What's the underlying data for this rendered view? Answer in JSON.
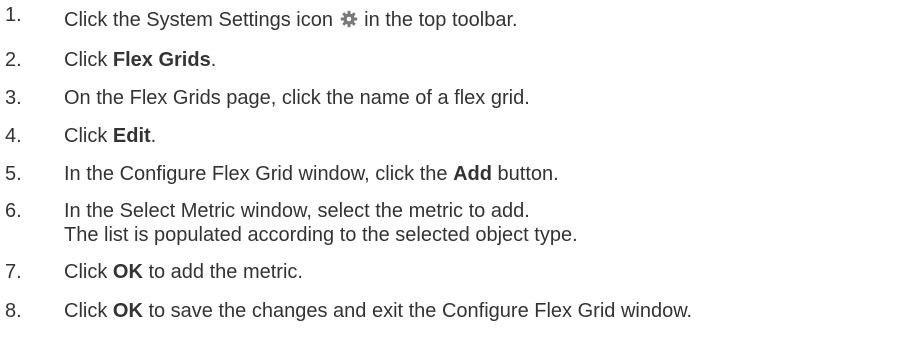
{
  "steps": [
    {
      "num": "1.",
      "pre": "Click the System Settings icon",
      "icon": "gear-icon",
      "post": "in the top toolbar."
    },
    {
      "num": "2.",
      "pre": "Click ",
      "bold": "Flex Grids",
      "post": "."
    },
    {
      "num": "3.",
      "text": "On the Flex Grids page, click the name of a flex grid."
    },
    {
      "num": "4.",
      "pre": "Click ",
      "bold": "Edit",
      "post": "."
    },
    {
      "num": "5.",
      "pre": "In the Configure Flex Grid window, click the ",
      "bold": "Add",
      "post": " button."
    },
    {
      "num": "6.",
      "line1": "In the Select Metric window, select the metric to add.",
      "line2": "The list is populated according to the selected object type."
    },
    {
      "num": "7.",
      "pre": "Click ",
      "bold": "OK",
      "post": " to add the metric."
    },
    {
      "num": "8.",
      "pre": "Click ",
      "bold": "OK",
      "post": " to save the changes and exit the Configure Flex Grid window."
    }
  ],
  "colors": {
    "text": "#333333",
    "icon": "#7a7a7a"
  }
}
